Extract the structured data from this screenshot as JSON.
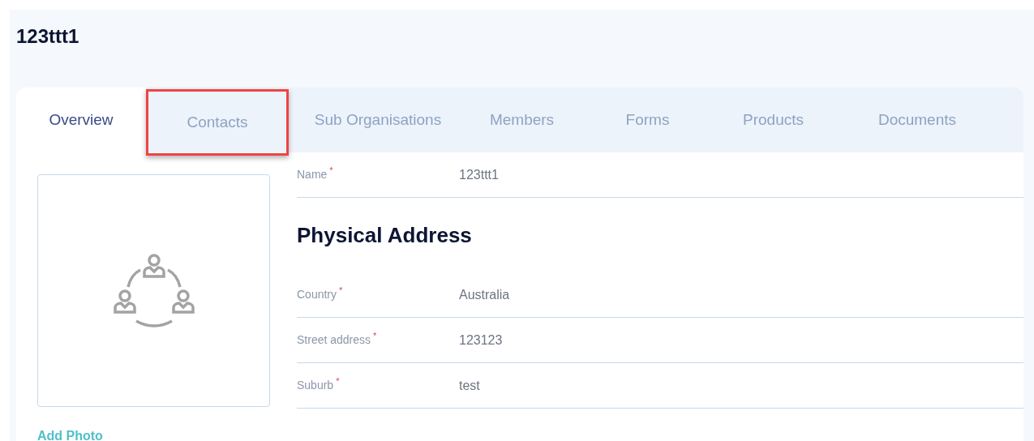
{
  "title": "123ttt1",
  "tabs": [
    {
      "label": "Overview",
      "selected": true,
      "highlighted": false
    },
    {
      "label": "Contacts",
      "selected": false,
      "highlighted": true
    },
    {
      "label": "Sub Organisations",
      "selected": false,
      "highlighted": false
    },
    {
      "label": "Members",
      "selected": false,
      "highlighted": false
    },
    {
      "label": "Forms",
      "selected": false,
      "highlighted": false
    },
    {
      "label": "Products",
      "selected": false,
      "highlighted": false
    },
    {
      "label": "Documents",
      "selected": false,
      "highlighted": false
    }
  ],
  "photo": {
    "link": "Add Photo"
  },
  "name_field": {
    "label": "Name",
    "required_mark": "*",
    "value": "123ttt1"
  },
  "section_heading": "Physical Address",
  "address_fields": [
    {
      "label": "Country",
      "required_mark": "*",
      "value": "Australia"
    },
    {
      "label": "Street address",
      "required_mark": "*",
      "value": "123123"
    },
    {
      "label": "Suburb",
      "required_mark": "*",
      "value": "test"
    }
  ]
}
